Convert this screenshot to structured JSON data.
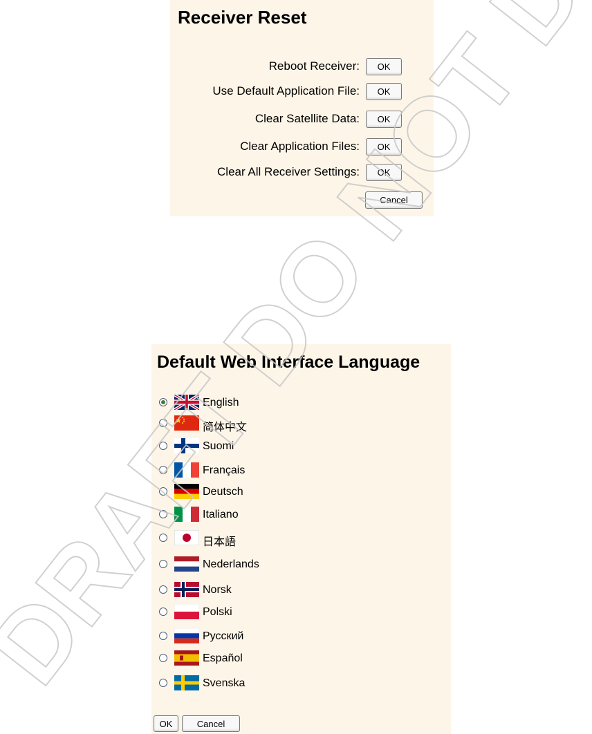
{
  "receiver_reset": {
    "title": "Receiver Reset",
    "rows": [
      {
        "label": "Reboot Receiver:",
        "button": "OK"
      },
      {
        "label": "Use Default Application File:",
        "button": "OK"
      },
      {
        "label": "Clear Satellite Data:",
        "button": "OK"
      },
      {
        "label": "Clear Application Files:",
        "button": "OK"
      },
      {
        "label": "Clear All Receiver Settings:",
        "button": "OK"
      }
    ],
    "cancel_label": "Cancel"
  },
  "language": {
    "title": "Default Web Interface Language",
    "selected": "English",
    "options": [
      {
        "label": "English",
        "flag": "uk-flag-icon"
      },
      {
        "label": "简体中文",
        "flag": "china-flag-icon"
      },
      {
        "label": "Suomi",
        "flag": "finland-flag-icon"
      },
      {
        "label": "Français",
        "flag": "france-flag-icon"
      },
      {
        "label": "Deutsch",
        "flag": "germany-flag-icon"
      },
      {
        "label": "Italiano",
        "flag": "italy-flag-icon"
      },
      {
        "label": "日本語",
        "flag": "japan-flag-icon"
      },
      {
        "label": "Nederlands",
        "flag": "netherlands-flag-icon"
      },
      {
        "label": "Norsk",
        "flag": "norway-flag-icon"
      },
      {
        "label": "Polski",
        "flag": "poland-flag-icon"
      },
      {
        "label": "Русский",
        "flag": "russia-flag-icon"
      },
      {
        "label": "Español",
        "flag": "spain-flag-icon"
      },
      {
        "label": "Svenska",
        "flag": "sweden-flag-icon"
      }
    ],
    "ok_label": "OK",
    "cancel_label": "Cancel"
  },
  "watermark": "DRAFT DO NOT DISTRIBUTE",
  "colors": {
    "panel_background": "#fdf5e8",
    "watermark": "#c8c8c8"
  }
}
